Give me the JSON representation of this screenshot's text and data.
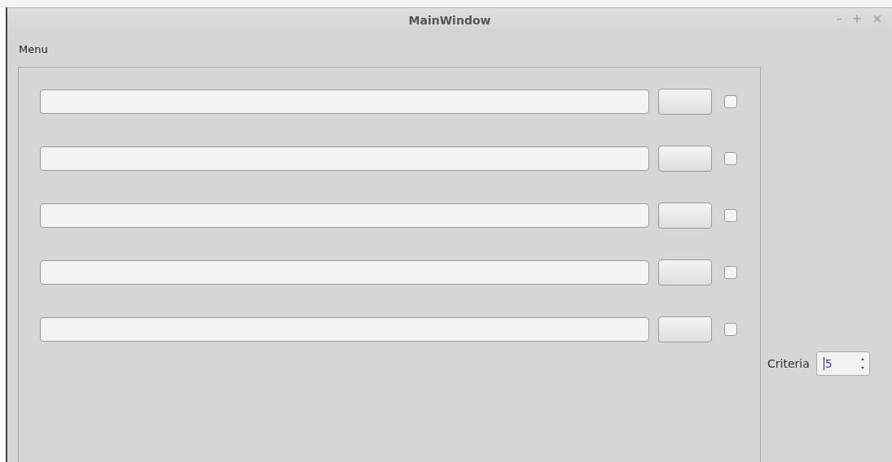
{
  "window": {
    "title": "MainWindow",
    "controls": [
      "–",
      "+",
      "×"
    ]
  },
  "menu_bar": [
    {
      "label": "Menu"
    }
  ],
  "rows": [
    {
      "checked": false
    },
    {
      "checked": false
    },
    {
      "checked": false
    },
    {
      "checked": false
    },
    {
      "checked": false
    }
  ],
  "criteria": {
    "label": "Criteria",
    "value": "5"
  }
}
